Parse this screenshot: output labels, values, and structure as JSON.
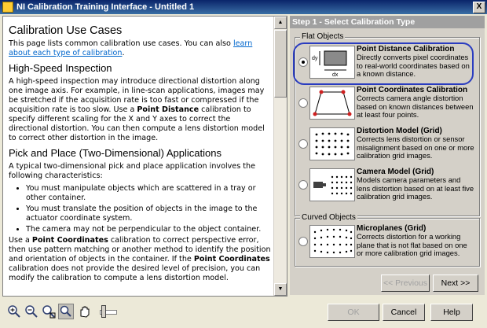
{
  "window": {
    "title": "NI Calibration Training Interface - Untitled 1",
    "close_glyph": "X"
  },
  "doc": {
    "h1": "Calibration Use Cases",
    "intro": "This page lists common calibration use cases. You can also ",
    "intro_link": "learn about each type of calibration",
    "intro_end": ".",
    "s1_title": "High-Speed Inspection",
    "s1_p1": "A high-speed inspection may introduce directional distortion along one image axis. For example, in line-scan applications, images may be stretched if the acquisition rate is too fast or compressed if the acquisition rate is too slow. Use a ",
    "s1_bold": "Point Distance",
    "s1_p2": " calibration to specify different scaling for the X and Y axes to correct the directional distortion. You can then compute a lens distortion model to correct other distortion in the image.",
    "s2_title": "Pick and Place (Two-Dimensional) Applications",
    "s2_intro": "A typical two-dimensional pick and place application involves the following characteristics:",
    "bullets": [
      "You must manipulate objects which are scattered in a tray or other container.",
      "You must translate the position of objects in the image to the actuator coordinate system.",
      "The camera may not be perpendicular to the object container."
    ],
    "s2_p1": "Use a ",
    "s2_b1": "Point Coordinates",
    "s2_p2": " calibration to correct perspective error, then use pattern matching or another method to identify the position and orientation of objects in the container. If the ",
    "s2_b2": "Point Coordinates",
    "s2_p3": " calibration does not provide the desired level of precision, you can modify the calibration to compute a lens distortion model."
  },
  "panel": {
    "step_title": "Step 1 - Select Calibration Type",
    "group_flat": "Flat Objects",
    "group_curved": "Curved Objects",
    "options": [
      {
        "title": "Point Distance Calibration",
        "desc": "Directly converts pixel coordinates to real-world coordinates based on a known distance.",
        "checked": true,
        "dy": "dy",
        "dx": "dx"
      },
      {
        "title": "Point Coordinates Calibration",
        "desc": "Corrects camera angle distortion based on known distances between at least four points.",
        "checked": false
      },
      {
        "title": "Distortion Model (Grid)",
        "desc": "Corrects lens distortion or sensor misalignment based on one or more calibration grid images.",
        "checked": false
      },
      {
        "title": "Camera Model (Grid)",
        "desc": "Models camera parameters and lens distortion based on at least five calibration grid images.",
        "checked": false
      },
      {
        "title": "Microplanes (Grid)",
        "desc": "Corrects distortion for a working plane that is not flat based on one or more calibration grid images.",
        "checked": false
      }
    ],
    "prev_label": "<< Previous",
    "next_label": "Next >>"
  },
  "footer": {
    "ok_label": "OK",
    "cancel_label": "Cancel",
    "help_label": "Help"
  },
  "icons": [
    "zoom-in-icon",
    "zoom-out-icon",
    "zoom-fit-icon",
    "zoom-selection-icon",
    "pan-icon"
  ]
}
